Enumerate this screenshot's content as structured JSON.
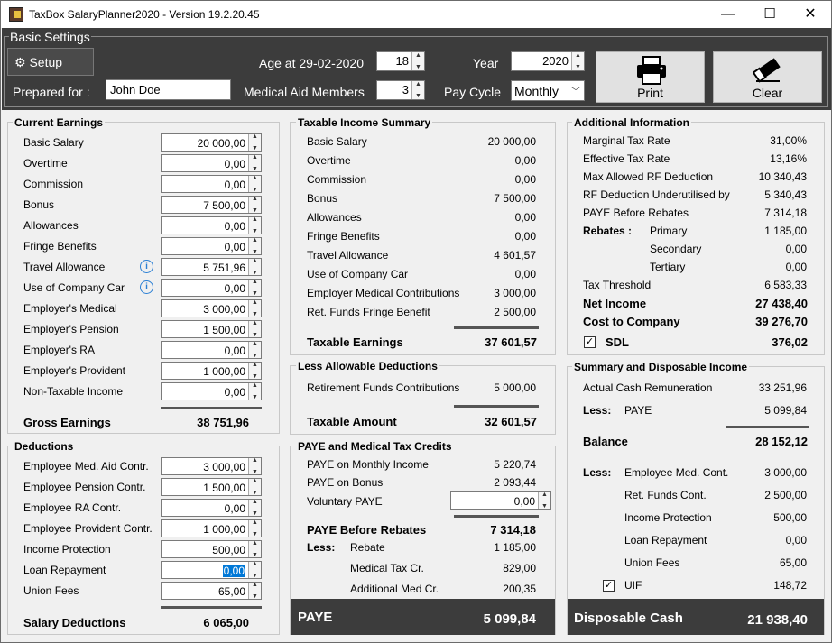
{
  "window": {
    "title": "TaxBox SalaryPlanner2020 - Version 19.2.20.45",
    "min": "—",
    "max": "☐",
    "close": "✕"
  },
  "basic": {
    "title": "Basic Settings",
    "setup": "Setup",
    "age_label": "Age at 29-02-2020",
    "age": "18",
    "year_label": "Year",
    "year": "2020",
    "prepared_label": "Prepared for :",
    "prepared": "John Doe",
    "medical_label": "Medical Aid Members",
    "medical": "3",
    "paycycle_label": "Pay Cycle",
    "paycycle": "Monthly",
    "print": "Print",
    "clear": "Clear"
  },
  "earnings": {
    "title": "Current Earnings",
    "items": [
      {
        "label": "Basic Salary",
        "value": "20 000,00"
      },
      {
        "label": "Overtime",
        "value": "0,00"
      },
      {
        "label": "Commission",
        "value": "0,00"
      },
      {
        "label": "Bonus",
        "value": "7 500,00"
      },
      {
        "label": "Allowances",
        "value": "0,00"
      },
      {
        "label": "Fringe Benefits",
        "value": "0,00"
      },
      {
        "label": "Travel Allowance",
        "value": "5 751,96"
      },
      {
        "label": "Use of Company Car",
        "value": "0,00"
      },
      {
        "label": "Employer's Medical",
        "value": "3 000,00"
      },
      {
        "label": "Employer's Pension",
        "value": "1 500,00"
      },
      {
        "label": "Employer's RA",
        "value": "0,00"
      },
      {
        "label": "Employer's Provident",
        "value": "1 000,00"
      },
      {
        "label": "Non-Taxable Income",
        "value": "0,00"
      }
    ],
    "total_label": "Gross Earnings",
    "total": "38 751,96",
    "info": "i"
  },
  "deductions": {
    "title": "Deductions",
    "items": [
      {
        "label": "Employee Med. Aid Contr.",
        "value": "3 000,00"
      },
      {
        "label": "Employee Pension Contr.",
        "value": "1 500,00"
      },
      {
        "label": "Employee RA Contr.",
        "value": "0,00"
      },
      {
        "label": "Employee Provident Contr.",
        "value": "1 000,00"
      },
      {
        "label": "Income Protection",
        "value": "500,00"
      },
      {
        "label": "Loan Repayment",
        "value": "0,00"
      },
      {
        "label": "Union Fees",
        "value": "65,00"
      }
    ],
    "total_label": "Salary Deductions",
    "total": "6 065,00"
  },
  "taxable": {
    "title": "Taxable Income Summary",
    "items": [
      {
        "label": "Basic Salary",
        "value": "20 000,00"
      },
      {
        "label": "Overtime",
        "value": "0,00"
      },
      {
        "label": "Commission",
        "value": "0,00"
      },
      {
        "label": "Bonus",
        "value": "7 500,00"
      },
      {
        "label": "Allowances",
        "value": "0,00"
      },
      {
        "label": "Fringe Benefits",
        "value": "0,00"
      },
      {
        "label": "Travel Allowance",
        "value": "4 601,57"
      },
      {
        "label": "Use of Company Car",
        "value": "0,00"
      },
      {
        "label": "Employer Medical Contributions",
        "value": "3 000,00"
      },
      {
        "label": "Ret. Funds Fringe Benefit",
        "value": "2 500,00"
      }
    ],
    "total_label": "Taxable Earnings",
    "total": "37 601,57"
  },
  "allowable": {
    "title": "Less Allowable Deductions",
    "item_label": "Retirement Funds Contributions",
    "item_value": "5 000,00",
    "total_label": "Taxable Amount",
    "total": "32 601,57"
  },
  "paye": {
    "title": "PAYE and Medical Tax Credits",
    "monthly_label": "PAYE on Monthly Income",
    "monthly": "5 220,74",
    "bonus_label": "PAYE on Bonus",
    "bonus": "2 093,44",
    "voluntary_label": "Voluntary PAYE",
    "voluntary": "0,00",
    "before_label": "PAYE Before Rebates",
    "before": "7 314,18",
    "less": "Less:",
    "rebate_label": "Rebate",
    "rebate": "1 185,00",
    "medcr_label": "Medical Tax Cr.",
    "medcr": "829,00",
    "addmed_label": "Additional Med Cr.",
    "addmed": "200,35",
    "bar_label": "PAYE",
    "bar_value": "5 099,84"
  },
  "additional": {
    "title": "Additional Information",
    "marginal_label": "Marginal Tax Rate",
    "marginal": "31,00%",
    "effective_label": "Effective Tax Rate",
    "effective": "13,16%",
    "maxrf_label": "Max Allowed RF Deduction",
    "maxrf": "10 340,43",
    "rfunder_label": "RF Deduction Underutilised by",
    "rfunder": "5 340,43",
    "payebr_label": "PAYE Before Rebates",
    "payebr": "7 314,18",
    "rebates_label": "Rebates :",
    "primary_label": "Primary",
    "primary": "1 185,00",
    "secondary_label": "Secondary",
    "secondary": "0,00",
    "tertiary_label": "Tertiary",
    "tertiary": "0,00",
    "threshold_label": "Tax Threshold",
    "threshold": "6 583,33",
    "net_label": "Net Income",
    "net": "27 438,40",
    "cost_label": "Cost to Company",
    "cost": "39 276,70",
    "sdl_label": "SDL",
    "sdl": "376,02",
    "check": "✓"
  },
  "summary": {
    "title": "Summary and Disposable Income",
    "actual_label": "Actual Cash Remuneration",
    "actual": "33 251,96",
    "less": "Less:",
    "paye_label": "PAYE",
    "paye": "5 099,84",
    "balance_label": "Balance",
    "balance": "28 152,12",
    "less2": "Less:",
    "items": [
      {
        "label": "Employee Med. Cont.",
        "value": "3 000,00"
      },
      {
        "label": "Ret. Funds Cont.",
        "value": "2 500,00"
      },
      {
        "label": "Income Protection",
        "value": "500,00"
      },
      {
        "label": "Loan Repayment",
        "value": "0,00"
      },
      {
        "label": "Union Fees",
        "value": "65,00"
      },
      {
        "label": "UIF",
        "value": "148,72"
      }
    ],
    "bar_label": "Disposable Cash",
    "bar_value": "21 938,40",
    "check": "✓"
  }
}
